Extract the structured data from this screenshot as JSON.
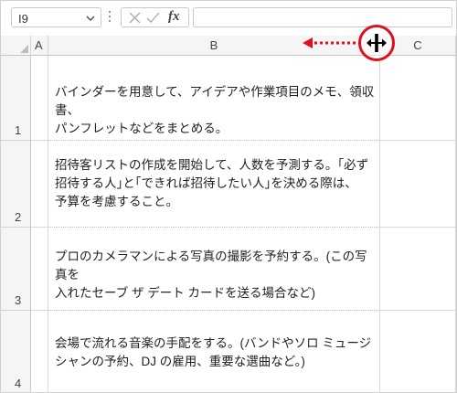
{
  "formula_bar": {
    "name_box_value": "I9",
    "name_box_dropdown_icon": "chevron-down-icon",
    "separator_icon": "vertical-dots-icon",
    "cancel_icon": "cancel-x-icon",
    "enter_icon": "checkmark-icon",
    "function_label": "fx",
    "formula_value": ""
  },
  "columns": [
    {
      "label": "A"
    },
    {
      "label": "B"
    },
    {
      "label": "C"
    }
  ],
  "rows": [
    {
      "number": "1",
      "b_text": "バインダーを用意して、アイデアや作業項目のメモ、領収書、\nパンフレットなどをまとめる。"
    },
    {
      "number": "2",
      "b_text": "招待客リストの作成を開始して、人数を予測する。｢必ず\n招待する人｣と｢できれば招待したい人｣を決める際は、\n予算を考慮すること。"
    },
    {
      "number": "3",
      "b_text": "プロのカメラマンによる写真の撮影を予約する。(この写真を\n入れたセーブ ザ デート カードを送る場合など)"
    },
    {
      "number": "4",
      "b_text": "会場で流れる音楽の手配をする。(バンドやソロ ミュージ\nシャンの予約、DJ の雇用、重要な選曲など。)"
    }
  ],
  "annotation": {
    "cursor_icon": "column-resize-cursor-icon",
    "arrow_icon": "dotted-left-arrow-icon",
    "accent_color": "#e0101c"
  }
}
